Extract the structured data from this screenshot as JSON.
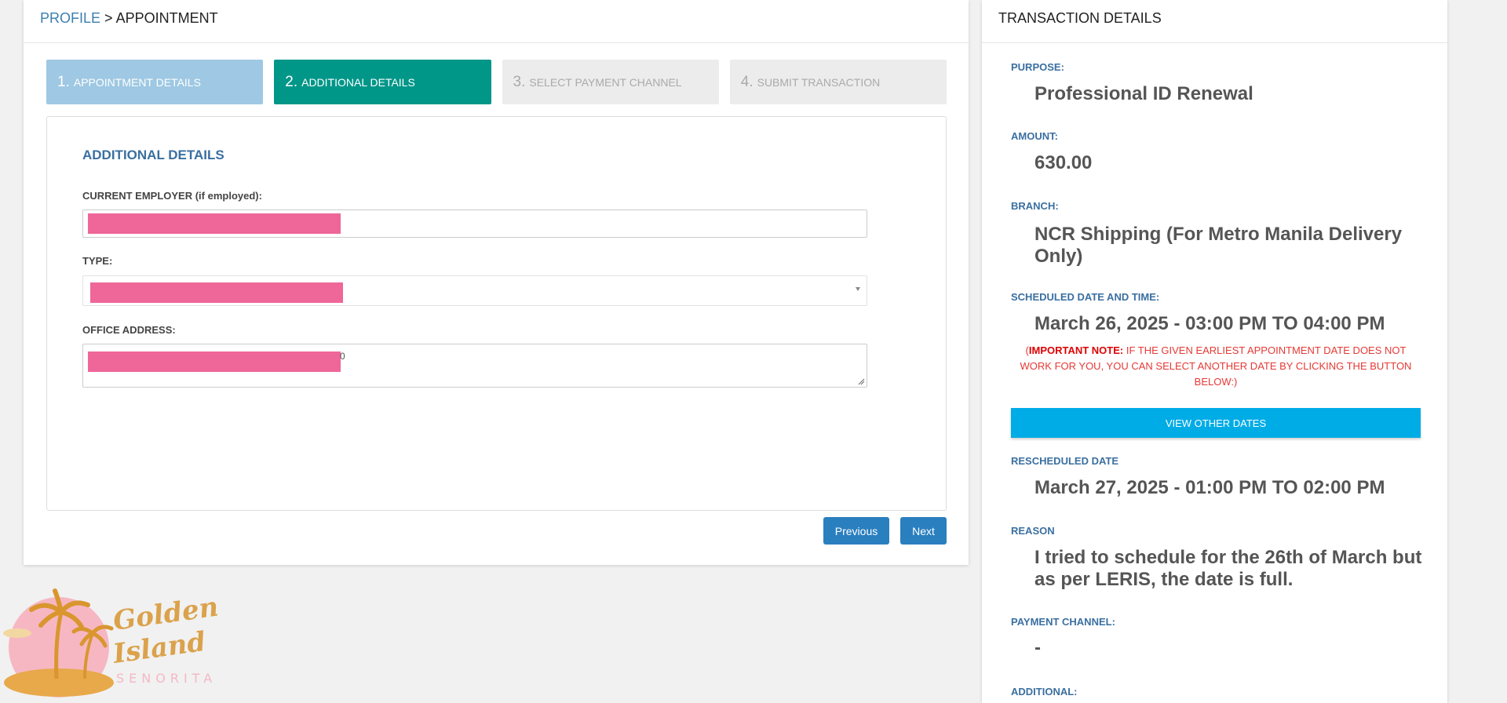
{
  "breadcrumb": {
    "link": "PROFILE",
    "separator": " > ",
    "current": "APPOINTMENT"
  },
  "steps": [
    {
      "num": "1.",
      "label": "APPOINTMENT DETAILS",
      "state": "done"
    },
    {
      "num": "2.",
      "label": "ADDITIONAL DETAILS",
      "state": "active"
    },
    {
      "num": "3.",
      "label": "SELECT PAYMENT CHANNEL",
      "state": "todo"
    },
    {
      "num": "4.",
      "label": "SUBMIT TRANSACTION",
      "state": "todo"
    }
  ],
  "form": {
    "title": "ADDITIONAL DETAILS",
    "employer_label": "CURRENT EMPLOYER (if employed):",
    "type_label": "TYPE:",
    "address_label": "OFFICE ADDRESS:",
    "address_stray": "0"
  },
  "buttons": {
    "previous": "Previous",
    "next": "Next"
  },
  "logo": {
    "line1": "Golden",
    "line2": "Island",
    "line3": "SENORITA"
  },
  "transaction": {
    "header": "TRANSACTION DETAILS",
    "purpose_label": "PURPOSE:",
    "purpose": "Professional ID Renewal",
    "amount_label": "AMOUNT:",
    "amount": "630.00",
    "branch_label": "BRANCH:",
    "branch": "NCR Shipping (For Metro Manila Delivery Only)",
    "schedule_label": "SCHEDULED DATE AND TIME:",
    "schedule": "March 26, 2025 - 03:00 PM TO 04:00 PM",
    "note_open": "(",
    "note_strong": "IMPORTANT NOTE:",
    "note_text": " IF THE GIVEN EARLIEST APPOINTMENT DATE DOES NOT WORK FOR YOU, YOU CAN SELECT ANOTHER DATE BY CLICKING THE BUTTON BELOW:)",
    "view_dates": "VIEW OTHER DATES",
    "rescheduled_label": "RESCHEDULED DATE",
    "rescheduled": "March 27, 2025 - 01:00 PM TO 02:00 PM",
    "reason_label": "REASON",
    "reason": "I tried to schedule for the 26th of March but as per LERIS, the date is full.",
    "payment_label": "PAYMENT CHANNEL:",
    "payment": "-",
    "additional_label": "ADDITIONAL:"
  },
  "colors": {
    "active_step": "#009688",
    "done_step": "#9ec8e3",
    "primary_button": "#2a7fbf",
    "view_button": "#00ace6",
    "redaction": "#ef6699",
    "label_blue": "#3a6fa0"
  }
}
